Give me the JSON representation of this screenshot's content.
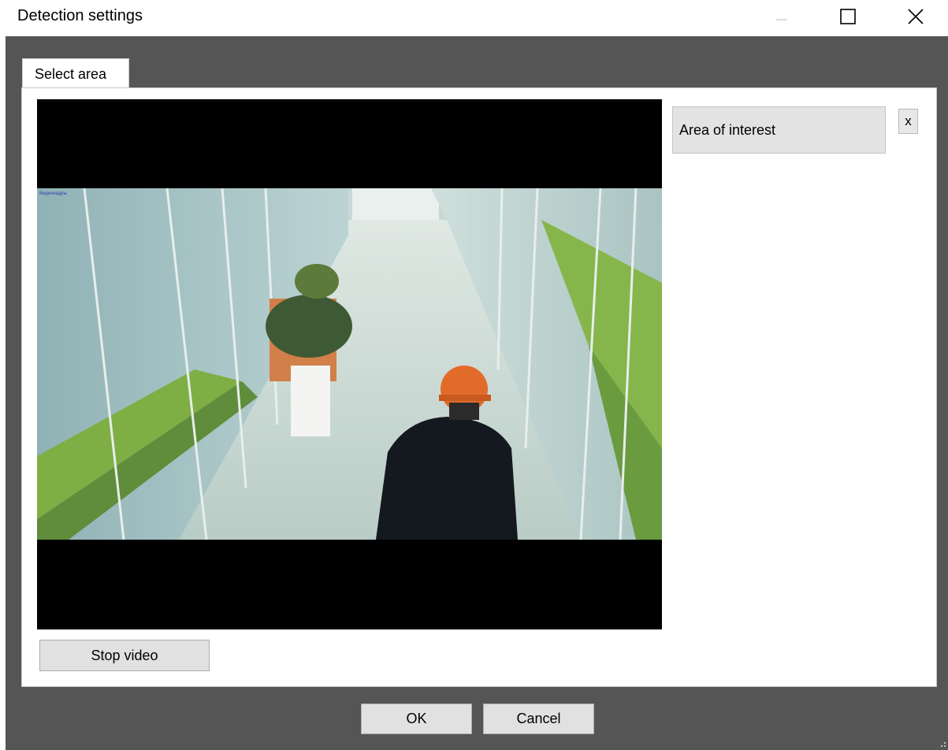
{
  "window": {
    "title": "Detection settings",
    "controls": {
      "minimize": "minimize-icon",
      "maximize": "maximize-icon",
      "close": "close-icon"
    }
  },
  "tabs": [
    {
      "label": "Select area",
      "selected": true
    }
  ],
  "video": {
    "overlay_label": "Видеокадры",
    "stop_button_label": "Stop video"
  },
  "areas": {
    "items": [
      {
        "label": "Area of interest"
      }
    ],
    "remove_label": "x"
  },
  "footer": {
    "ok_label": "OK",
    "cancel_label": "Cancel"
  },
  "colors": {
    "client_background": "#555555",
    "panel_background": "#ffffff",
    "button_face": "#e1e1e1",
    "video_background": "#000000"
  }
}
